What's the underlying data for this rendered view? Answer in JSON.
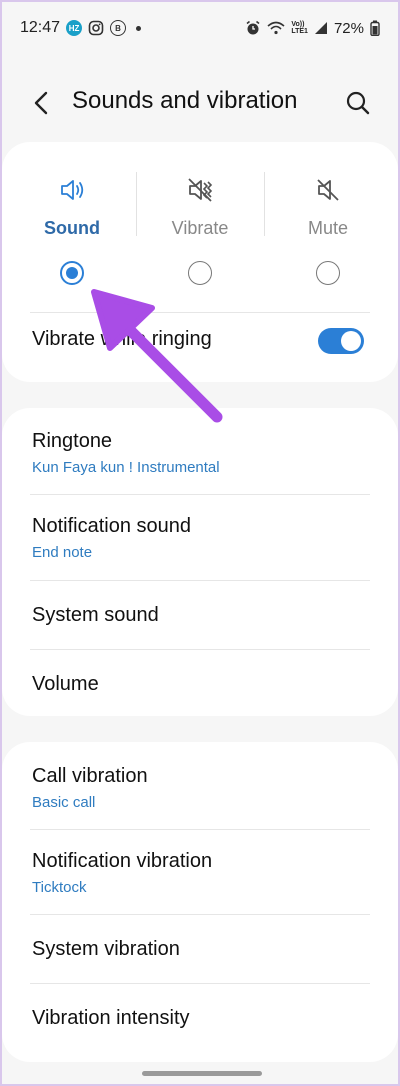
{
  "status_bar": {
    "time": "12:47",
    "badge_hz": "HZ",
    "badge_b": "B",
    "battery": "72%",
    "network": "LTE1",
    "network_vo": "Vo))"
  },
  "header": {
    "title": "Sounds and vibration"
  },
  "sound_modes": [
    {
      "label": "Sound",
      "icon": "speaker-icon",
      "selected": true
    },
    {
      "label": "Vibrate",
      "icon": "vibrate-icon",
      "selected": false
    },
    {
      "label": "Mute",
      "icon": "mute-icon",
      "selected": false
    }
  ],
  "vibrate_while_ringing": {
    "label": "Vibrate while ringing",
    "enabled": true
  },
  "ringtone_section": {
    "ringtone": {
      "title": "Ringtone",
      "value": "Kun Faya kun ! Instrumental"
    },
    "notification_sound": {
      "title": "Notification sound",
      "value": "End note"
    },
    "system_sound": {
      "title": "System sound"
    },
    "volume": {
      "title": "Volume"
    }
  },
  "vibration_section": {
    "call_vibration": {
      "title": "Call vibration",
      "value": "Basic call"
    },
    "notification_vibration": {
      "title": "Notification vibration",
      "value": "Ticktock"
    },
    "system_vibration": {
      "title": "System vibration"
    },
    "vibration_intensity": {
      "title": "Vibration intensity"
    }
  },
  "colors": {
    "accent": "#2b7fd6",
    "annotation_arrow": "#a94de6",
    "subtitle": "#2f7cc0"
  }
}
